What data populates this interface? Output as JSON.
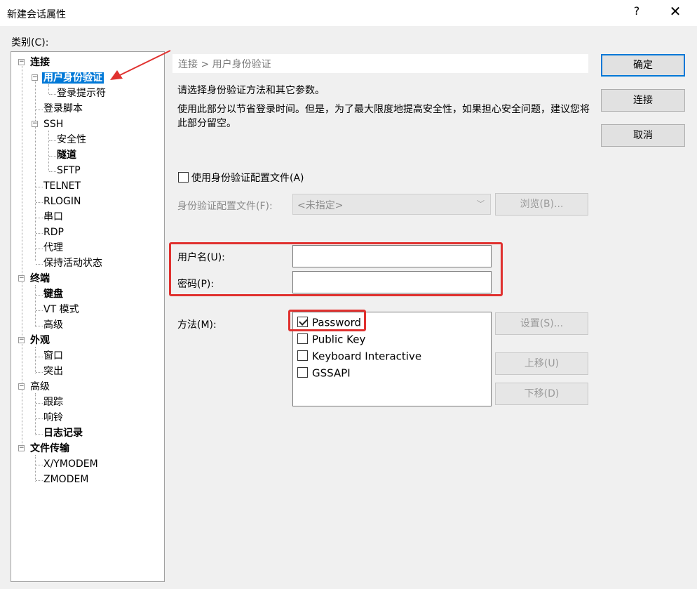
{
  "window": {
    "title": "新建会话属性",
    "help": "?",
    "close": "✕"
  },
  "category_label": "类别(C):",
  "tree": {
    "connection": "连接",
    "user_auth": "用户身份验证",
    "login_prompt": "登录提示符",
    "login_script": "登录脚本",
    "ssh": "SSH",
    "security": "安全性",
    "tunnel": "隧道",
    "sftp": "SFTP",
    "telnet": "TELNET",
    "rlogin": "RLOGIN",
    "serial": "串口",
    "rdp": "RDP",
    "proxy": "代理",
    "keepalive": "保持活动状态",
    "terminal": "终端",
    "keyboard": "键盘",
    "vt_mode": "VT 模式",
    "advanced": "高级",
    "appearance": "外观",
    "window": "窗口",
    "highlight": "突出",
    "advanced2": "高级",
    "trace": "跟踪",
    "bell": "响铃",
    "logging": "日志记录",
    "file_transfer": "文件传输",
    "xymodem": "X/YMODEM",
    "zmodem": "ZMODEM"
  },
  "breadcrumb": "连接 > 用户身份验证",
  "description_1": "请选择身份验证方法和其它参数。",
  "description_2": "使用此部分以节省登录时间。但是，为了最大限度地提高安全性，如果担心安全问题，建议您将此部分留空。",
  "auth_profile": {
    "checkbox_label": "使用身份验证配置文件(A)",
    "checked": false,
    "file_label": "身份验证配置文件(F):",
    "file_value": "<未指定>",
    "browse_button": "浏览(B)..."
  },
  "username": {
    "label": "用户名(U):",
    "value": ""
  },
  "password": {
    "label": "密码(P):",
    "value": ""
  },
  "method": {
    "label": "方法(M):",
    "items": [
      {
        "label": "Password",
        "checked": true
      },
      {
        "label": "Public Key",
        "checked": false
      },
      {
        "label": "Keyboard Interactive",
        "checked": false
      },
      {
        "label": "GSSAPI",
        "checked": false
      }
    ],
    "settings_button": "设置(S)...",
    "move_up_button": "上移(U)",
    "move_down_button": "下移(D)"
  },
  "buttons": {
    "ok": "确定",
    "connect": "连接",
    "cancel": "取消"
  },
  "colors": {
    "accent": "#0078d7",
    "annotation_red": "#e0312f"
  }
}
